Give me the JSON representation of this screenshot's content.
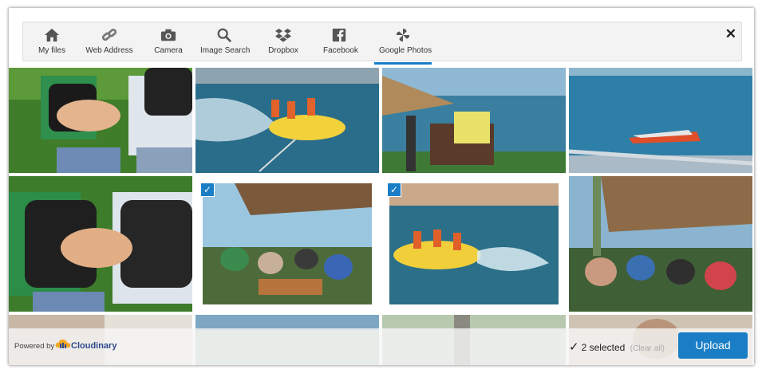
{
  "tabs": [
    {
      "label": "My files",
      "icon": "home-icon"
    },
    {
      "label": "Web Address",
      "icon": "link-icon"
    },
    {
      "label": "Camera",
      "icon": "camera-icon"
    },
    {
      "label": "Image Search",
      "icon": "search-icon"
    },
    {
      "label": "Dropbox",
      "icon": "dropbox-icon"
    },
    {
      "label": "Facebook",
      "icon": "facebook-icon"
    },
    {
      "label": "Google Photos",
      "icon": "google-photos-icon",
      "active": true
    }
  ],
  "close_icon": "close-icon",
  "photos": [
    {
      "description": "people hugging with backpacks",
      "selected": false
    },
    {
      "description": "tube ride on lake",
      "selected": false
    },
    {
      "description": "chairs under parasol by lake",
      "selected": false
    },
    {
      "description": "speedboat on lake",
      "selected": false
    },
    {
      "description": "people hugging with backpacks",
      "selected": false
    },
    {
      "description": "group sitting under parasol",
      "selected": true
    },
    {
      "description": "tube ride on lake",
      "selected": true
    },
    {
      "description": "group sitting under palm roof",
      "selected": false
    }
  ],
  "footer": {
    "powered_by": "Powered by",
    "brand": "Cloudinary",
    "selected_text": "2 selected",
    "clear_all": "(Clear all)",
    "upload_label": "Upload"
  },
  "colors": {
    "accent": "#1a7ec7"
  }
}
